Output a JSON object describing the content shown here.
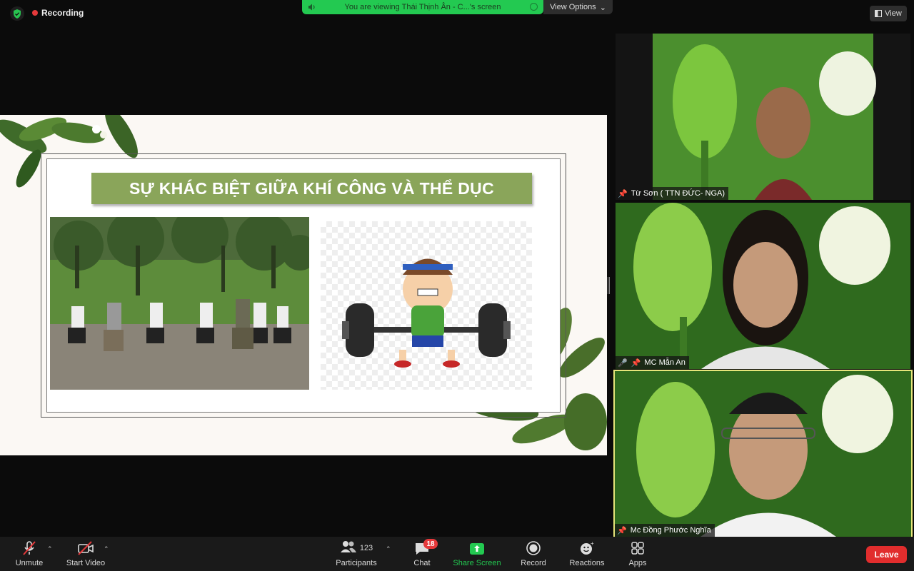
{
  "top": {
    "recording_label": "Recording",
    "viewing_text": "You are viewing Thái Thịnh Ân - C...'s screen",
    "view_options_label": "View Options",
    "view_label": "View"
  },
  "slide": {
    "title": "SỰ KHÁC BIỆT GIỮA KHÍ CÔNG VÀ THỂ DỤC"
  },
  "participants_tiles": [
    {
      "name": "Từ Sơn ( TTN ĐỨC- NGA)"
    },
    {
      "name": "MC Mẫn An"
    },
    {
      "name": "Mc Đồng Phước Nghĩa"
    }
  ],
  "toolbar": {
    "unmute": "Unmute",
    "start_video": "Start Video",
    "participants_label": "Participants",
    "participants_count": "123",
    "chat_label": "Chat",
    "chat_badge": "18",
    "share_label": "Share Screen",
    "record_label": "Record",
    "reactions_label": "Reactions",
    "apps_label": "Apps",
    "leave_label": "Leave"
  },
  "colors": {
    "share_green": "#23c951",
    "leave_red": "#e12d2d",
    "slide_title_bg": "#8aa55a",
    "active_speaker_border": "#e6e57a"
  }
}
